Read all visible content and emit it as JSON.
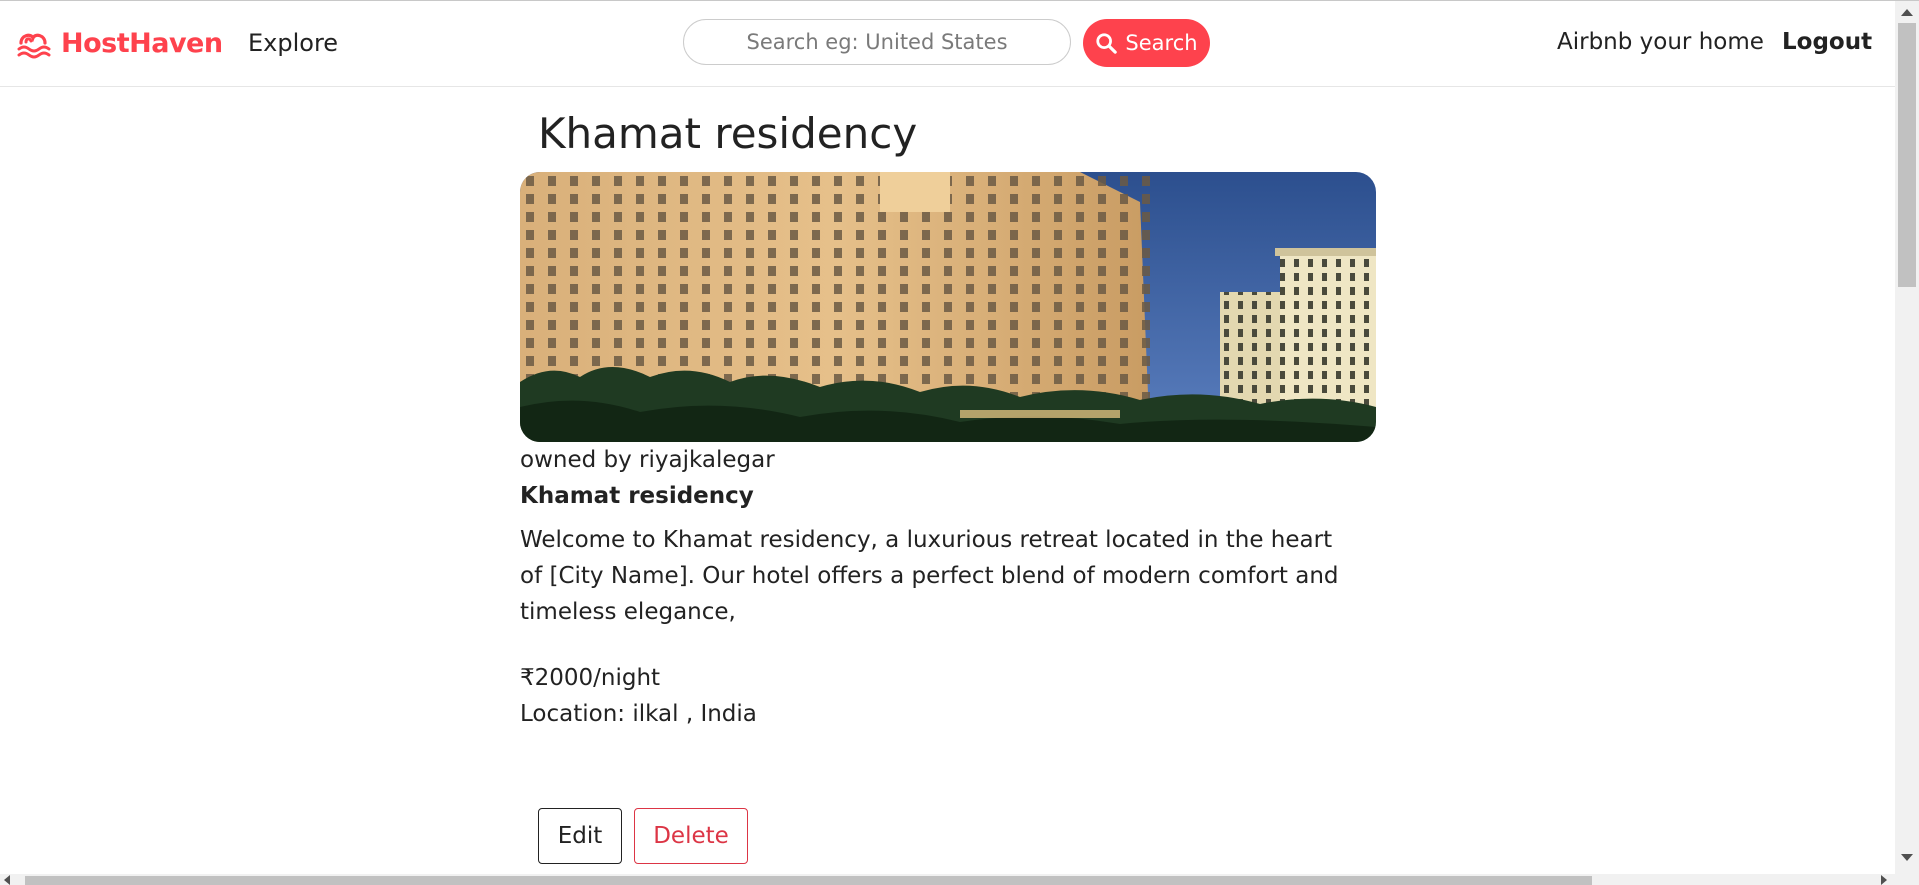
{
  "navbar": {
    "brand": "HostHaven",
    "brand_icon": "airbnb-logo-icon",
    "brand_color": "#fe424d",
    "explore": "Explore",
    "search": {
      "placeholder": "Search eg: United States",
      "value": "",
      "button_label": "Search",
      "button_icon": "magnifying-glass-icon"
    },
    "host_link": "Airbnb your home",
    "logout": "Logout"
  },
  "listing": {
    "title": "Khamat residency",
    "image_description": "hotel-building-photo",
    "owner_text": "owned by riyajkalegar",
    "name": "Khamat residency",
    "description": "Welcome to Khamat residency, a luxurious retreat located in the heart of [City Name]. Our hotel offers a perfect blend of modern comfort and timeless elegance,",
    "price": "₹2000/night",
    "location": "Location: ilkal , India"
  },
  "actions": {
    "edit": "Edit",
    "delete": "Delete",
    "delete_color": "#dc3545"
  }
}
